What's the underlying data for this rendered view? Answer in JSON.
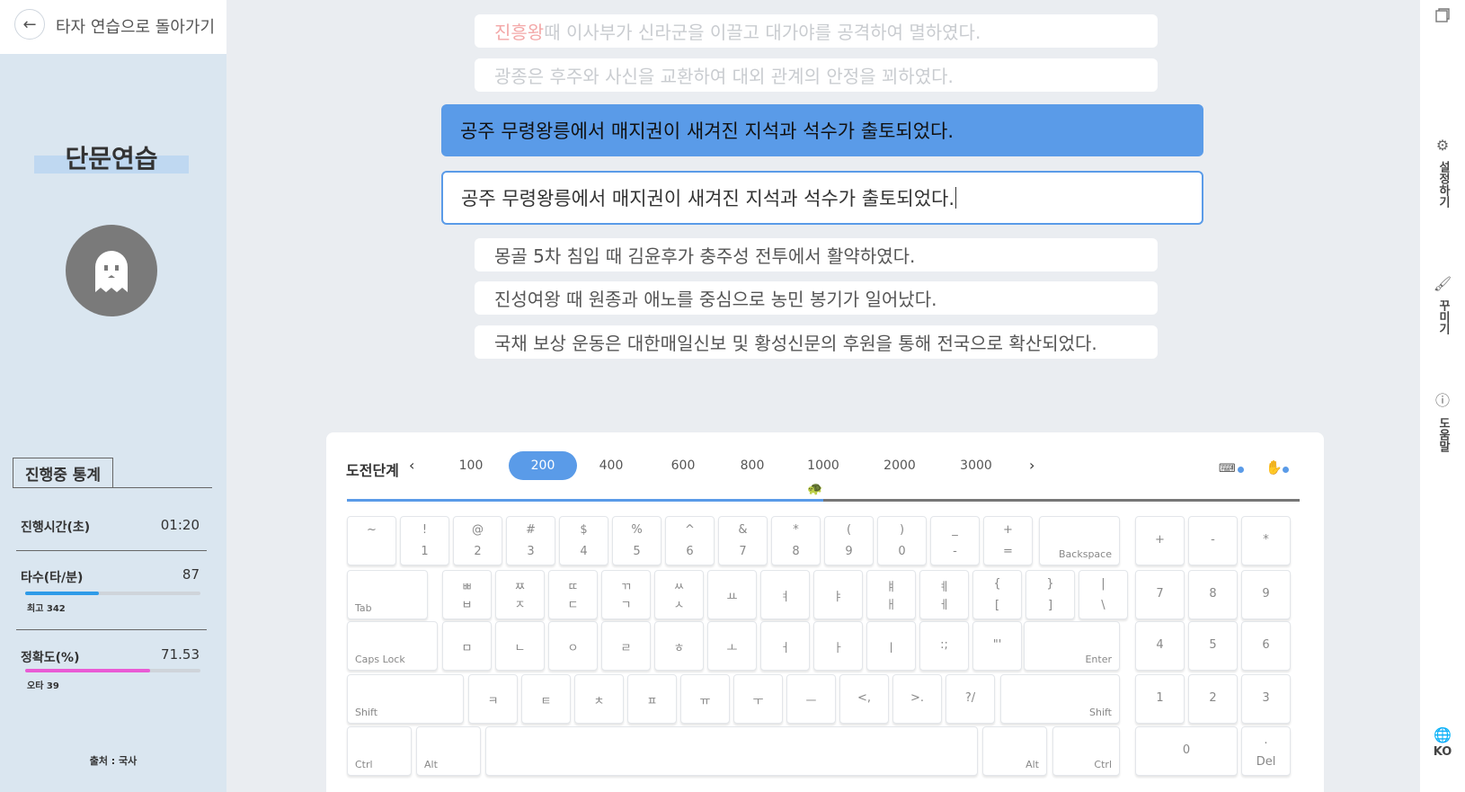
{
  "back": {
    "label": "타자 연습으로 돌아가기"
  },
  "mode": {
    "title": "단문연습"
  },
  "stats": {
    "tab": "진행중 통계",
    "time_label": "진행시간(초)",
    "time_value": "01:20",
    "speed_label": "타수(타/분)",
    "speed_value": "87",
    "speed_best": "최고 342",
    "speed_progress": 0.42,
    "accuracy_label": "정확도(%)",
    "accuracy_value": "71.53",
    "accuracy_errors": "오타 39",
    "accuracy_progress": 0.7153,
    "speed_color": "#2f9be8",
    "accuracy_color": "#e95bd5"
  },
  "source": "출처 : 국사",
  "sentences": {
    "prev2_highlight": "진흥왕",
    "prev2_rest": " 때 이사부가 신라군을 이끌고 대가야를 공격하여 멸하였다.",
    "prev1": "광종은 후주와 사신을 교환하여 대외 관계의 안정을 꾀하였다.",
    "current": "공주 무령왕릉에서 매지권이 새겨진 지석과 석수가 출토되었다.",
    "typed": "공주 무령왕릉에서 매지권이 새겨진 지석과 석수가 출토되었다.",
    "next1": "몽골 5차 침입 때 김윤후가 충주성 전투에서 활약하였다.",
    "next2": "진성여왕 때 원종과 애노를 중심으로 농민 봉기가 일어났다.",
    "next3": "국채 보상 운동은 대한매일신보 및 황성신문의 후원을 통해 전국으로 확산되었다."
  },
  "levels": {
    "label": "도전단계",
    "prev": "‹",
    "next": "›",
    "items": [
      "100",
      "200",
      "400",
      "600",
      "800",
      "1000",
      "2000",
      "3000"
    ],
    "active": "200",
    "progress": 0.5
  },
  "keyboard": {
    "row1": [
      {
        "t": "~",
        "b": ""
      },
      {
        "t": "!",
        "b": "1"
      },
      {
        "t": "@",
        "b": "2"
      },
      {
        "t": "#",
        "b": "3"
      },
      {
        "t": "$",
        "b": "4"
      },
      {
        "t": "%",
        "b": "5"
      },
      {
        "t": "^",
        "b": "6"
      },
      {
        "t": "&",
        "b": "7"
      },
      {
        "t": "*",
        "b": "8"
      },
      {
        "t": "(",
        "b": "9"
      },
      {
        "t": ")",
        "b": "0"
      },
      {
        "t": "_",
        "b": "-"
      },
      {
        "t": "+",
        "b": "="
      }
    ],
    "backspace": "Backspace",
    "tab": "Tab",
    "row2": [
      {
        "t": "ㅃ",
        "b": "ㅂ"
      },
      {
        "t": "ㅉ",
        "b": "ㅈ"
      },
      {
        "t": "ㄸ",
        "b": "ㄷ"
      },
      {
        "t": "ㄲ",
        "b": "ㄱ"
      },
      {
        "t": "ㅆ",
        "b": "ㅅ"
      },
      {
        "t": "",
        "b": "",
        "m": "ㅛ"
      },
      {
        "t": "",
        "b": "",
        "m": "ㅕ"
      },
      {
        "t": "",
        "b": "",
        "m": "ㅑ"
      },
      {
        "t": "ㅒ",
        "b": "ㅐ"
      },
      {
        "t": "ㅖ",
        "b": "ㅔ"
      },
      {
        "t": "{",
        "b": "["
      },
      {
        "t": "}",
        "b": "]"
      },
      {
        "t": "|",
        "b": "\\"
      }
    ],
    "capslock": "Caps Lock",
    "row3": [
      "ㅁ",
      "ㄴ",
      "ㅇ",
      "ㄹ",
      "ㅎ",
      "ㅗ",
      "ㅓ",
      "ㅏ",
      "ㅣ",
      ":;",
      "\"'"
    ],
    "enter": "Enter",
    "shift": "Shift",
    "row4": [
      "ㅋ",
      "ㅌ",
      "ㅊ",
      "ㅍ",
      "ㅠ",
      "ㅜ",
      "ㅡ",
      "<,",
      ">.",
      "?/"
    ],
    "ctrl": "Ctrl",
    "alt": "Alt",
    "numpad": {
      "r1": [
        "+",
        "-",
        "*"
      ],
      "r2": [
        "7",
        "8",
        "9"
      ],
      "r3": [
        "4",
        "5",
        "6"
      ],
      "r4": [
        "1",
        "2",
        "3"
      ],
      "zero": "0",
      "del_top": ".",
      "del": "Del"
    }
  },
  "right_menu": {
    "settings": "설정하기",
    "decorate": "꾸미기",
    "help": "도움말",
    "lang": "KO"
  }
}
